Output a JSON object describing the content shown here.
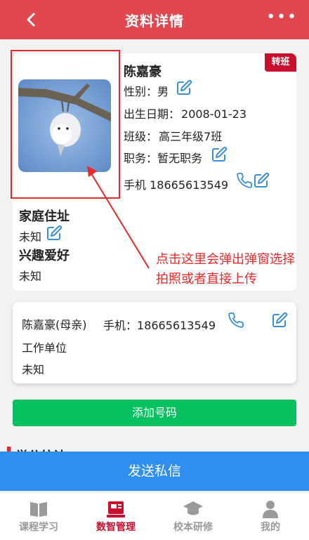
{
  "header": {
    "title": "资料详情",
    "back_icon": "chevron-left-icon",
    "more_icon": "more-dots-icon",
    "more_label": "•••"
  },
  "profile": {
    "badge": "转班",
    "name": "陈嘉豪",
    "gender_label": "性别：",
    "gender": "男",
    "birth_label": "出生日期：",
    "birth": "2008-01-23",
    "class_label": "班级：",
    "class": "高三年级7班",
    "duty_label": "职务：",
    "duty": "暂无职务",
    "phone_label": "手机",
    "phone": "18665613549"
  },
  "address": {
    "title": "家庭住址",
    "value": "未知"
  },
  "hobby": {
    "title": "兴趣爱好",
    "value": "未知"
  },
  "annotation": "点击这里会弹出弹窗选择拍照或者直接上传",
  "contact": {
    "name": "陈嘉豪(母亲)",
    "phone_label": "手机：",
    "phone": "18665613549",
    "work_label": "工作单位",
    "work": "未知"
  },
  "buttons": {
    "add_number": "添加号码",
    "send_message": "发送私信"
  },
  "stats": {
    "title": "学分统计"
  },
  "tabs": [
    {
      "label": "课程学习",
      "icon": "book-icon",
      "active": false
    },
    {
      "label": "数智管理",
      "icon": "management-icon",
      "active": true
    },
    {
      "label": "校本研修",
      "icon": "graduation-cap-icon",
      "active": false
    },
    {
      "label": "我的",
      "icon": "user-icon",
      "active": false
    }
  ],
  "colors": {
    "header": "#e0474f",
    "accent": "#c8102e",
    "icon_blue": "#3b8fd6",
    "green": "#07c160",
    "blue": "#2e8ff0",
    "annotation": "#e8282a"
  }
}
